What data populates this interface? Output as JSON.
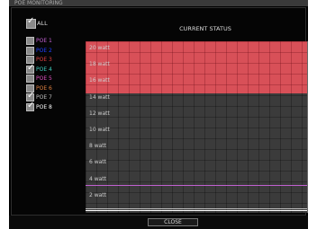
{
  "window": {
    "title": "POE MONITORING"
  },
  "all_checkbox": {
    "label": "ALL",
    "checked": true
  },
  "ports": [
    {
      "label": "POE 1",
      "color": "#c060d0",
      "checked": false
    },
    {
      "label": "POE 2",
      "color": "#2040ff",
      "checked": false
    },
    {
      "label": "POE 3",
      "color": "#e04040",
      "checked": false
    },
    {
      "label": "POE 4",
      "color": "#40d0c0",
      "checked": true
    },
    {
      "label": "POE 5",
      "color": "#e050c0",
      "checked": false
    },
    {
      "label": "POE 6",
      "color": "#e08040",
      "checked": false
    },
    {
      "label": "POE 7",
      "color": "#c0c0c0",
      "checked": true
    },
    {
      "label": "POE 8",
      "color": "#ffffff",
      "checked": true
    }
  ],
  "status": {
    "title": "CURRENT STATUS"
  },
  "chart_data": {
    "type": "line",
    "yticks": [
      "20 watt",
      "18 watt",
      "16 watt",
      "14 watt",
      "12 watt",
      "10 watt",
      "8 watt",
      "6 watt",
      "4 watt",
      "2 watt"
    ],
    "ylim": [
      0,
      21
    ],
    "warning_band_from": 15,
    "grid": true,
    "series": [
      {
        "color": "#c060d0",
        "value": 3.3
      },
      {
        "color": "#c0c0c0",
        "value": 0.4
      },
      {
        "color": "#ffffff",
        "value": 0.2
      }
    ]
  },
  "footer": {
    "close_label": "CLOSE"
  }
}
